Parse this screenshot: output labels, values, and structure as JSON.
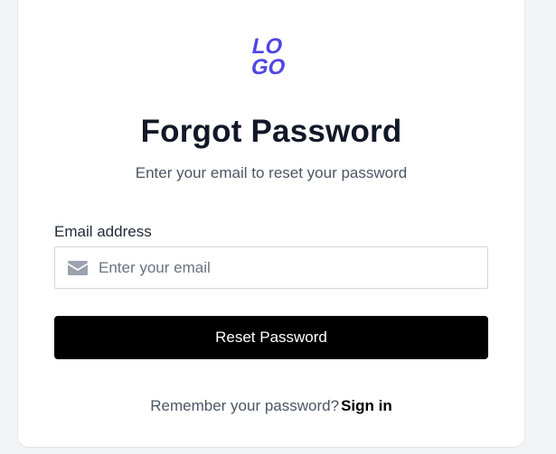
{
  "logo": {
    "text_line1": "LO",
    "text_line2": "GO",
    "color": "#4f46e5"
  },
  "page": {
    "title": "Forgot Password",
    "subtitle": "Enter your email to reset your password"
  },
  "form": {
    "email_label": "Email address",
    "email_placeholder": "Enter your email",
    "email_value": "",
    "email_icon": "envelope-icon",
    "submit_label": "Reset Password"
  },
  "footer": {
    "prompt": "Remember your password?",
    "signin_label": "Sign in"
  },
  "colors": {
    "button_bg": "#000000",
    "title": "#111827",
    "muted_text": "#4b5563",
    "input_border": "#d1d5db",
    "icon": "#9ca3af"
  }
}
